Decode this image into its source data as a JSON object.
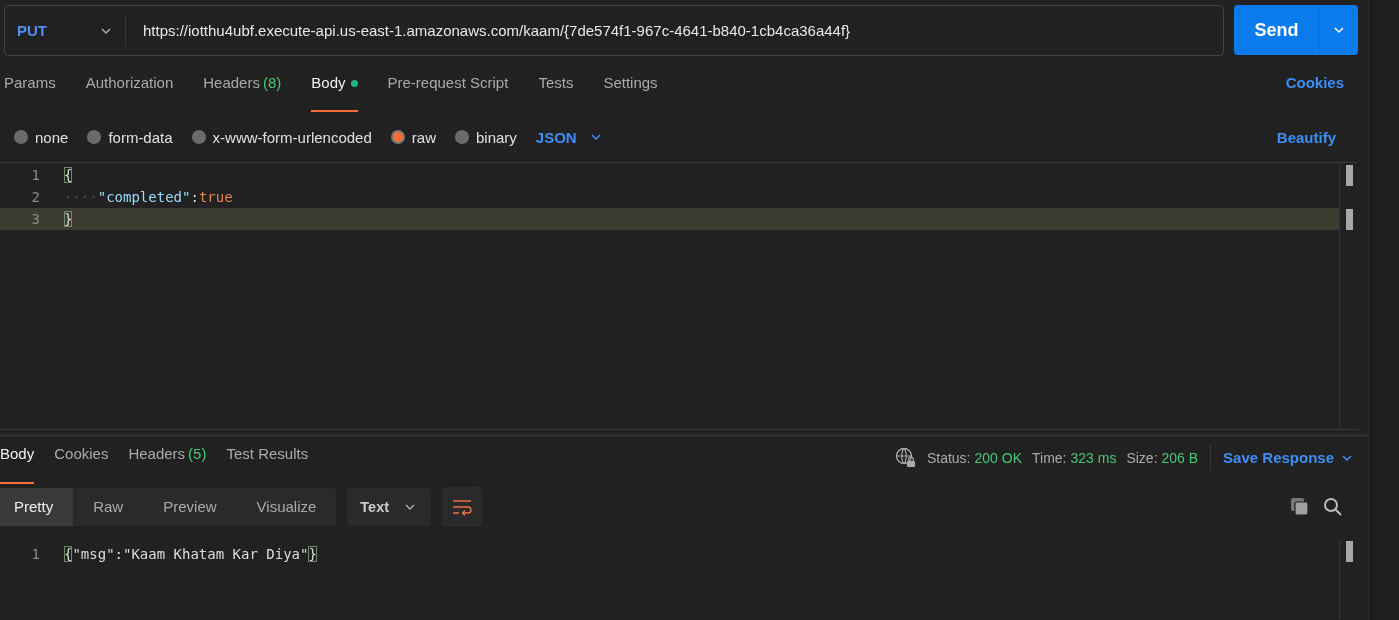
{
  "request": {
    "method": "PUT",
    "url": "https://iotthu4ubf.execute-api.us-east-1.amazonaws.com/kaam/{7de574f1-967c-4641-b840-1cb4ca36a44f}",
    "send": "Send"
  },
  "request_tabs": [
    {
      "label": "Params",
      "selected": false,
      "indicator": false
    },
    {
      "label": "Authorization",
      "selected": false,
      "indicator": false
    },
    {
      "label": "Headers",
      "count": "(8)",
      "selected": false,
      "indicator": false
    },
    {
      "label": "Body",
      "selected": true,
      "indicator": true
    },
    {
      "label": "Pre-request Script",
      "selected": false,
      "indicator": false
    },
    {
      "label": "Tests",
      "selected": false,
      "indicator": false
    },
    {
      "label": "Settings",
      "selected": false,
      "indicator": false
    }
  ],
  "cookies_link": "Cookies",
  "body_types": [
    {
      "label": "none",
      "selected": false
    },
    {
      "label": "form-data",
      "selected": false
    },
    {
      "label": "x-www-form-urlencoded",
      "selected": false
    },
    {
      "label": "raw",
      "selected": true
    },
    {
      "label": "binary",
      "selected": false
    }
  ],
  "language": "JSON",
  "beautify": "Beautify",
  "editor_lines": [
    {
      "number": "1",
      "current": false,
      "tokens": [
        {
          "kind": "bracket-match",
          "text": "{"
        }
      ]
    },
    {
      "number": "2",
      "current": false,
      "tokens": [
        {
          "kind": "whitespace",
          "text": "····"
        },
        {
          "kind": "key",
          "text": "\"completed\""
        },
        {
          "kind": "punct",
          "text": ":"
        },
        {
          "kind": "bool",
          "text": "true"
        }
      ]
    },
    {
      "number": "3",
      "current": true,
      "tokens": [
        {
          "kind": "bracket-match",
          "text": "}"
        }
      ]
    }
  ],
  "response_tabs": [
    {
      "label": "Body",
      "selected": true
    },
    {
      "label": "Cookies",
      "selected": false
    },
    {
      "label": "Headers",
      "count": "(5)",
      "selected": false
    },
    {
      "label": "Test Results",
      "selected": false
    }
  ],
  "response_stats": [
    {
      "label": "Status:",
      "value": "200 OK"
    },
    {
      "label": "Time:",
      "value": "323 ms"
    },
    {
      "label": "Size:",
      "value": "206 B"
    }
  ],
  "save_response": "Save Response",
  "view_modes": [
    {
      "label": "Pretty",
      "selected": true
    },
    {
      "label": "Raw",
      "selected": false
    },
    {
      "label": "Preview",
      "selected": false
    },
    {
      "label": "Visualize",
      "selected": false
    }
  ],
  "response_format": "Text",
  "response_lines": [
    {
      "number": "1",
      "tokens": [
        {
          "kind": "bracket-match",
          "text": "{"
        },
        {
          "kind": "plain",
          "text": "\"msg\":\"Kaam Khatam Kar Diya\""
        },
        {
          "kind": "bracket-match",
          "text": "}"
        }
      ]
    }
  ]
}
